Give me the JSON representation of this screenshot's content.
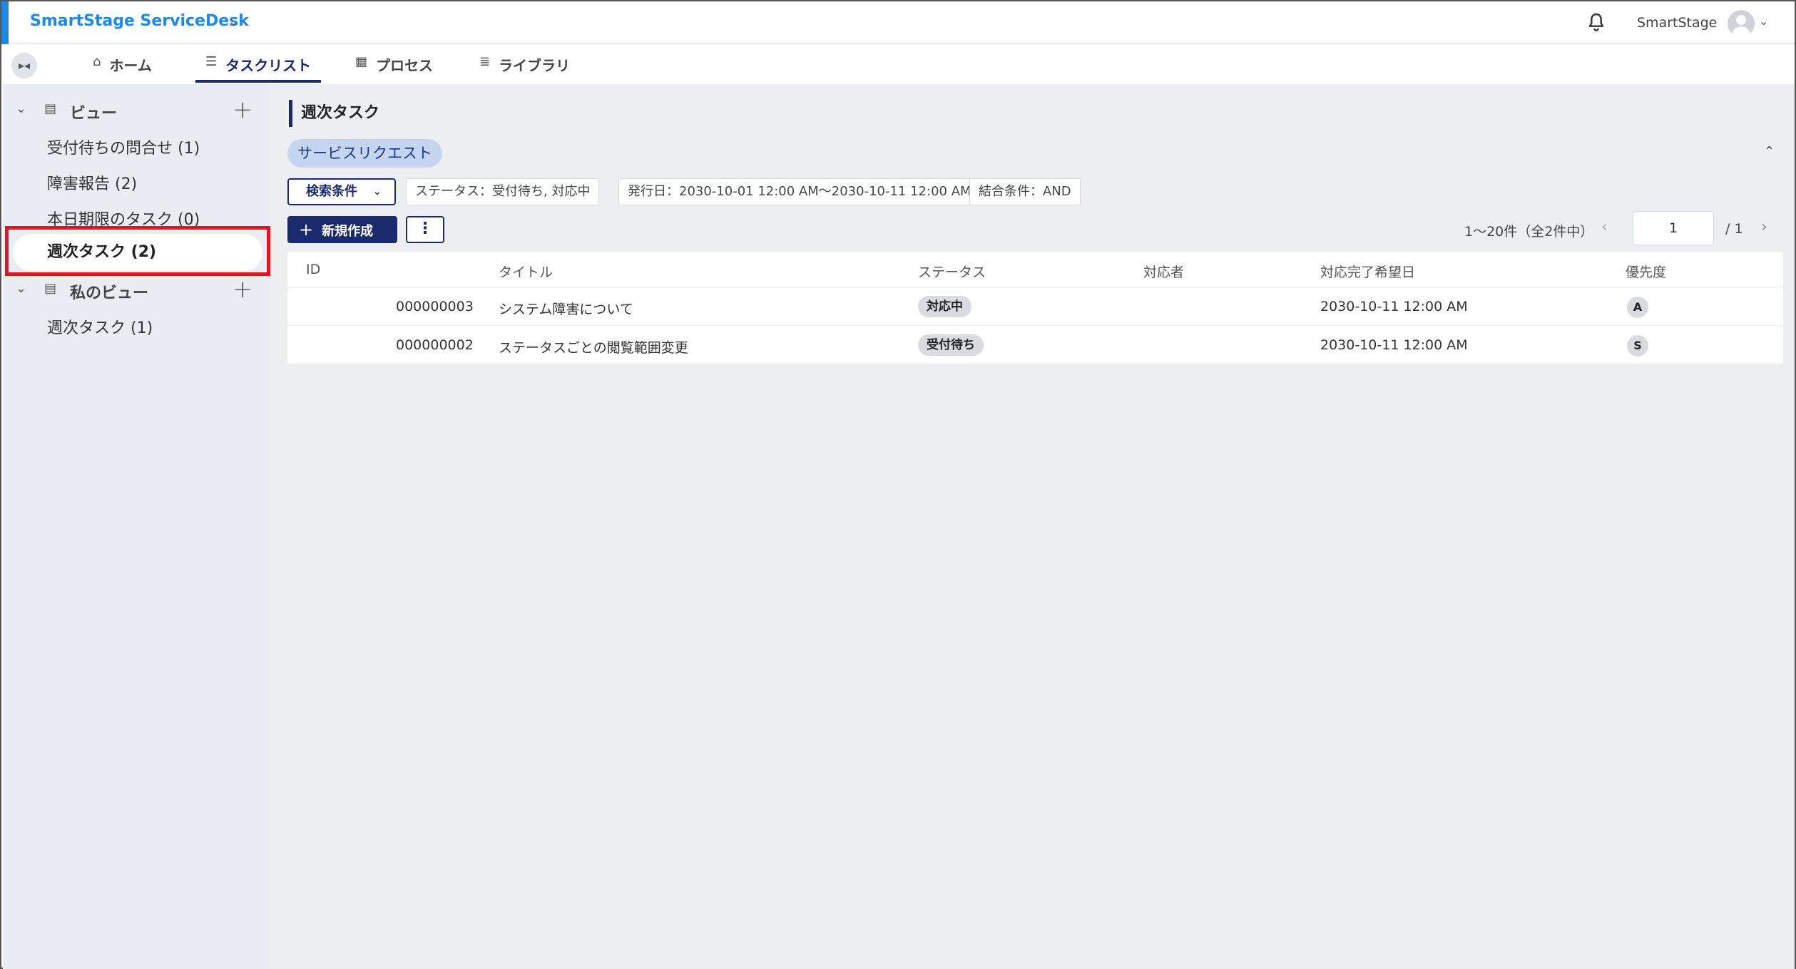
{
  "header": {
    "app_title": "SmartStage ServiceDesk",
    "user_name": "SmartStage"
  },
  "nav": {
    "tabs": [
      {
        "label": "ホーム",
        "icon": "home-icon"
      },
      {
        "label": "タスクリスト",
        "icon": "tasklist-icon",
        "active": true
      },
      {
        "label": "プロセス",
        "icon": "building-icon"
      },
      {
        "label": "ライブラリ",
        "icon": "list-icon"
      }
    ]
  },
  "sidebar": {
    "views_label": "ビュー",
    "views": [
      {
        "label": "受付待ちの問合せ (1)"
      },
      {
        "label": "障害報告 (2)"
      },
      {
        "label": "本日期限のタスク (0)"
      },
      {
        "label": "週次タスク (2)",
        "active": true
      }
    ],
    "my_views_label": "私のビュー",
    "my_views": [
      {
        "label": "週次タスク (1)"
      }
    ]
  },
  "main": {
    "title": "週次タスク",
    "category_chip": "サービスリクエスト",
    "filter_button": "検索条件",
    "filters": [
      "ステータス：受付待ち, 対応中",
      "発行日：2030-10-01 12:00 AM〜2030-10-11 12:00 AM",
      "結合条件：AND"
    ],
    "new_button": "新規作成",
    "more_button": "⋮",
    "pager": {
      "summary": "1〜20件（全2件中）",
      "current_page": "1",
      "total": "/ 1"
    },
    "table": {
      "columns": [
        "ID",
        "タイトル",
        "ステータス",
        "対応者",
        "対応完了希望日",
        "優先度"
      ],
      "rows": [
        {
          "id": "000000003",
          "title": "システム障害について",
          "status": "対応中",
          "assignee": "",
          "due": "2030-10-11 12:00 AM",
          "priority": "A"
        },
        {
          "id": "000000002",
          "title": "ステータスごとの閲覧範囲変更",
          "status": "受付待ち",
          "assignee": "",
          "due": "2030-10-11 12:00 AM",
          "priority": "S"
        }
      ]
    }
  },
  "colors": {
    "brand": "#1e88e5",
    "primary": "#1a2a6c",
    "highlight": "#e3141f",
    "chip_bg": "#c5d5f0"
  }
}
